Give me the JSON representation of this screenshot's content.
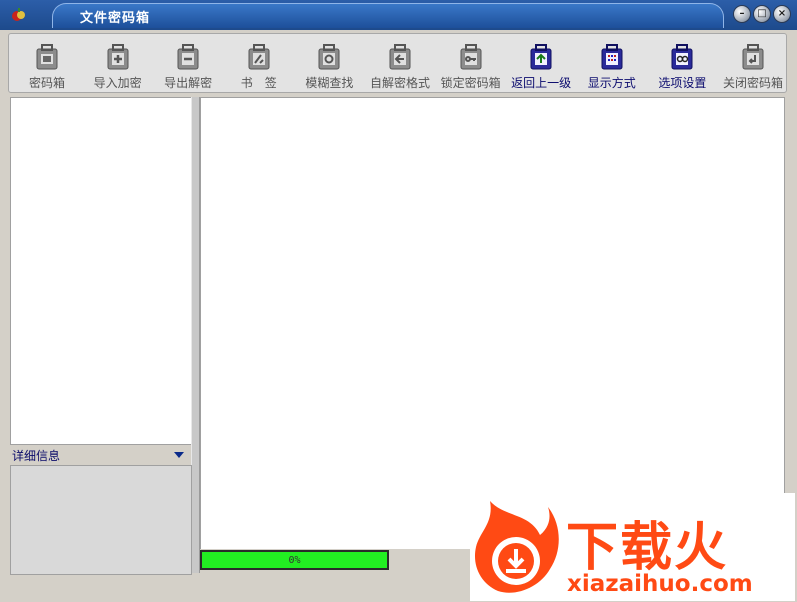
{
  "window": {
    "title": "文件密码箱",
    "controls": [
      "minimize",
      "restore",
      "close"
    ]
  },
  "toolbar": {
    "items": [
      {
        "label": "密码箱",
        "icon": "safe-icon",
        "active": false
      },
      {
        "label": "导入加密",
        "icon": "plus-icon",
        "active": false
      },
      {
        "label": "导出解密",
        "icon": "minus-icon",
        "active": false
      },
      {
        "label": "书　签",
        "icon": "bookmark-icon",
        "active": false
      },
      {
        "label": "模糊查找",
        "icon": "search-icon",
        "active": false
      },
      {
        "label": "自解密格式",
        "icon": "self-extract-icon",
        "active": false
      },
      {
        "label": "锁定密码箱",
        "icon": "key-icon",
        "active": false
      },
      {
        "label": "返回上一级",
        "icon": "up-arrow-icon",
        "active": true
      },
      {
        "label": "显示方式",
        "icon": "view-mode-icon",
        "active": true
      },
      {
        "label": "选项设置",
        "icon": "settings-icon",
        "active": true
      },
      {
        "label": "关闭密码箱",
        "icon": "close-box-icon",
        "active": false
      }
    ]
  },
  "left_panel": {
    "detail_label": "详细信息"
  },
  "status": {
    "progress_text": "0%",
    "progress_value": 1.0,
    "progress_color": "#22ee22"
  },
  "watermark": {
    "chinese": "下载火",
    "domain": "xiazaihuo.com",
    "color": "#ff4a14"
  }
}
